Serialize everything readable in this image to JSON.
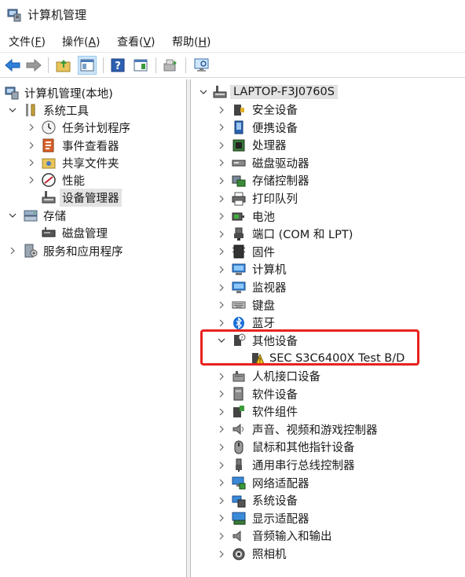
{
  "window": {
    "title": "计算机管理"
  },
  "menu": [
    {
      "label": "文件(",
      "key": "F",
      "suffix": ")"
    },
    {
      "label": "操作(",
      "key": "A",
      "suffix": ")"
    },
    {
      "label": "查看(",
      "key": "V",
      "suffix": ")"
    },
    {
      "label": "帮助(",
      "key": "H",
      "suffix": ")"
    }
  ],
  "left_tree": {
    "root": "计算机管理(本地)",
    "system_tools": "系统工具",
    "task_scheduler": "任务计划程序",
    "event_viewer": "事件查看器",
    "shared_folders": "共享文件夹",
    "performance": "性能",
    "device_manager": "设备管理器",
    "storage": "存储",
    "disk_management": "磁盘管理",
    "services_apps": "服务和应用程序"
  },
  "right_tree": {
    "root": "LAPTOP-F3J0760S",
    "items": [
      "安全设备",
      "便携设备",
      "处理器",
      "磁盘驱动器",
      "存储控制器",
      "打印队列",
      "电池",
      "端口 (COM 和 LPT)",
      "固件",
      "计算机",
      "监视器",
      "键盘",
      "蓝牙"
    ],
    "other_devices": "其他设备",
    "other_device_child": "SEC S3C6400X Test B/D",
    "items_after": [
      "人机接口设备",
      "软件设备",
      "软件组件",
      "声音、视频和游戏控制器",
      "鼠标和其他指针设备",
      "通用串行总线控制器",
      "网络适配器",
      "系统设备",
      "显示适配器",
      "音频输入和输出",
      "照相机"
    ]
  },
  "colors": {
    "highlight": "#e8221f",
    "selection": "#e3e3e3",
    "toolbar_pressed": "#cce4f7"
  }
}
